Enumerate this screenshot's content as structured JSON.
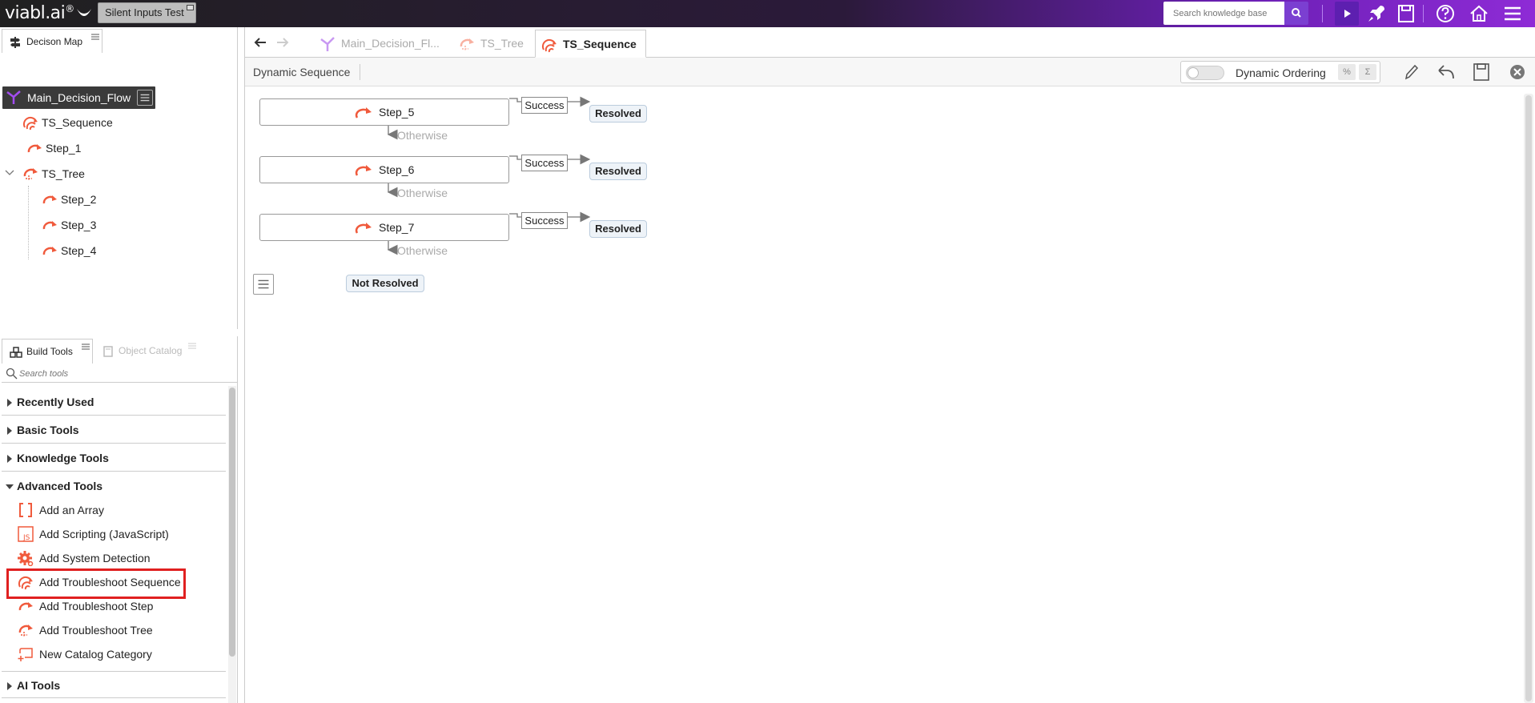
{
  "topbar": {
    "logo_text": "viabl.ai",
    "logo_reg": "®",
    "project_tab": "Silent Inputs Test",
    "search_placeholder": "Search knowledge base",
    "icons": [
      "play-icon",
      "rocket-icon",
      "save-icon",
      "help-icon",
      "home-icon",
      "hamburger-icon"
    ]
  },
  "decision_map": {
    "tab_label": "Decison Map",
    "root": "Main_Decision_Flow",
    "items": [
      {
        "label": "TS_Sequence",
        "icon": "troubleshoot-sequence-icon"
      },
      {
        "label": "Step_1",
        "icon": "troubleshoot-step-icon"
      },
      {
        "label": "TS_Tree",
        "icon": "troubleshoot-tree-icon"
      },
      {
        "label": "Step_2",
        "icon": "troubleshoot-step-icon"
      },
      {
        "label": "Step_3",
        "icon": "troubleshoot-step-icon"
      },
      {
        "label": "Step_4",
        "icon": "troubleshoot-step-icon"
      }
    ]
  },
  "build_tools": {
    "tab_label": "Build Tools",
    "catalog_tab_label": "Object Catalog",
    "search_placeholder": "Search tools",
    "sections": {
      "recently_used": "Recently Used",
      "basic_tools": "Basic Tools",
      "knowledge_tools": "Knowledge Tools",
      "advanced_tools": "Advanced Tools",
      "ai_tools": "AI Tools"
    },
    "advanced_items": [
      {
        "label": "Add an Array",
        "icon": "array-icon"
      },
      {
        "label": "Add Scripting (JavaScript)",
        "icon": "javascript-icon"
      },
      {
        "label": "Add System Detection",
        "icon": "gear-icon"
      },
      {
        "label": "Add Troubleshoot Sequence",
        "icon": "troubleshoot-sequence-icon"
      },
      {
        "label": "Add Troubleshoot Step",
        "icon": "troubleshoot-step-icon"
      },
      {
        "label": "Add Troubleshoot Tree",
        "icon": "troubleshoot-tree-icon"
      },
      {
        "label": "New Catalog Category",
        "icon": "catalog-category-icon"
      }
    ]
  },
  "editor": {
    "tabs": [
      {
        "label": "Main_Decision_Fl...",
        "active": false
      },
      {
        "label": "TS_Tree",
        "active": false
      },
      {
        "label": "TS_Sequence",
        "active": true
      }
    ],
    "toolbar": {
      "title": "Dynamic Sequence",
      "dynamic_ordering_label": "Dynamic Ordering",
      "dynamic_ordering_on": false,
      "btn_percent": "%",
      "btn_sigma": "Σ"
    },
    "sequence": {
      "steps": [
        {
          "name": "Step_5",
          "success_label": "Success",
          "outcome": "Resolved",
          "otherwise": "Otherwise"
        },
        {
          "name": "Step_6",
          "success_label": "Success",
          "outcome": "Resolved",
          "otherwise": "Otherwise"
        },
        {
          "name": "Step_7",
          "success_label": "Success",
          "outcome": "Resolved",
          "otherwise": "Otherwise"
        }
      ],
      "final_outcome": "Not Resolved"
    }
  },
  "colors": {
    "accent": "#f05a3c",
    "purple": "#7b3fd1",
    "highlight": "#e02020"
  }
}
